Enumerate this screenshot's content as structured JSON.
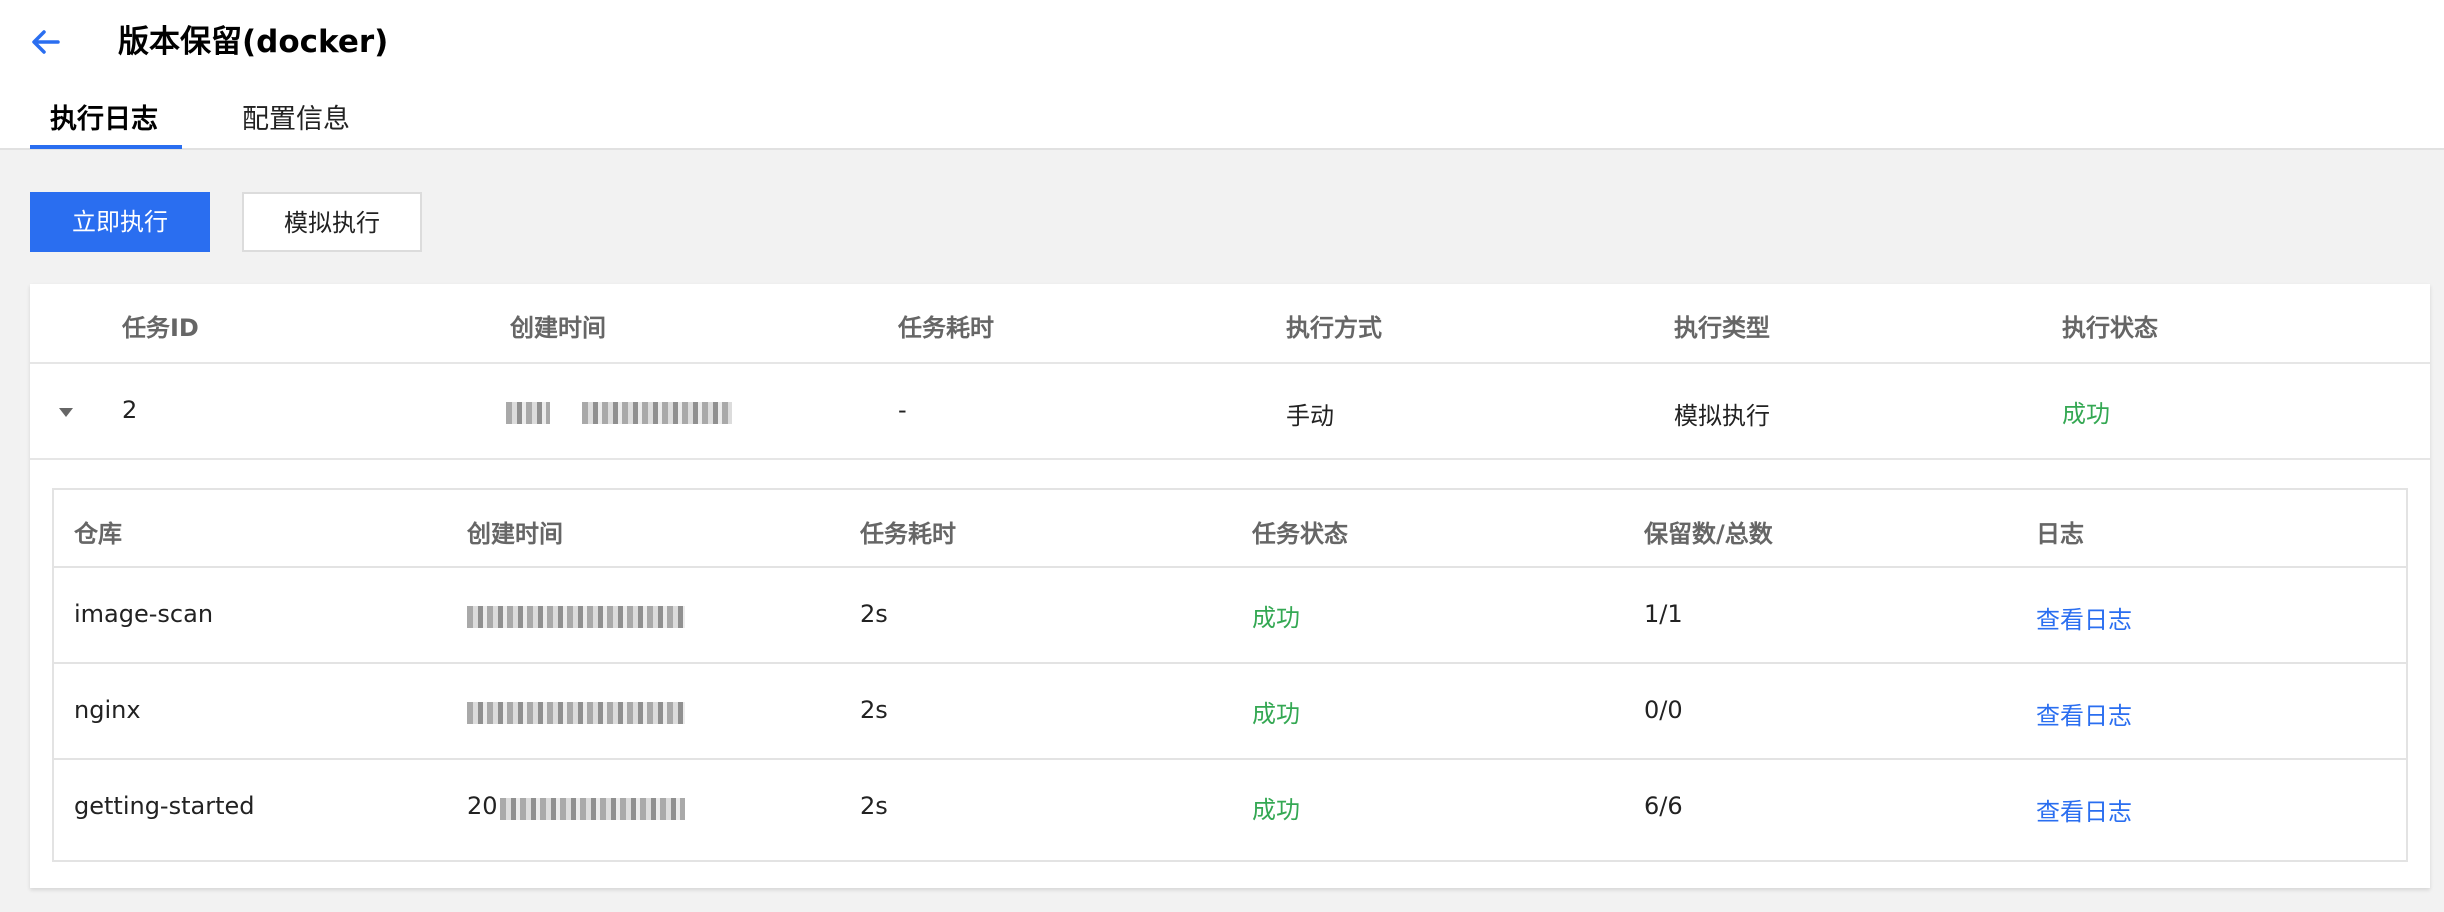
{
  "header": {
    "title": "版本保留(docker)",
    "back_icon": "arrow-left-icon"
  },
  "tabs": [
    {
      "label": "执行日志",
      "active": true
    },
    {
      "label": "配置信息",
      "active": false
    }
  ],
  "toolbar": {
    "run_now_label": "立即执行",
    "simulate_label": "模拟执行"
  },
  "colors": {
    "accent": "#2a6ef0",
    "success": "#34a853"
  },
  "task_table": {
    "columns": [
      "任务ID",
      "创建时间",
      "任务耗时",
      "执行方式",
      "执行类型",
      "执行状态"
    ],
    "rows": [
      {
        "id": "2",
        "created": "",
        "duration": "-",
        "mode": "手动",
        "type": "模拟执行",
        "status": "成功"
      }
    ]
  },
  "repo_table": {
    "columns": [
      "仓库",
      "创建时间",
      "任务耗时",
      "任务状态",
      "保留数/总数",
      "日志"
    ],
    "rows": [
      {
        "repo": "image-scan",
        "created": "",
        "duration": "2s",
        "status": "成功",
        "ratio": "1/1",
        "log": "查看日志"
      },
      {
        "repo": "nginx",
        "created": "",
        "duration": "2s",
        "status": "成功",
        "ratio": "0/0",
        "log": "查看日志"
      },
      {
        "repo": "getting-started",
        "created": "20",
        "duration": "2s",
        "status": "成功",
        "ratio": "6/6",
        "log": "查看日志"
      }
    ]
  }
}
